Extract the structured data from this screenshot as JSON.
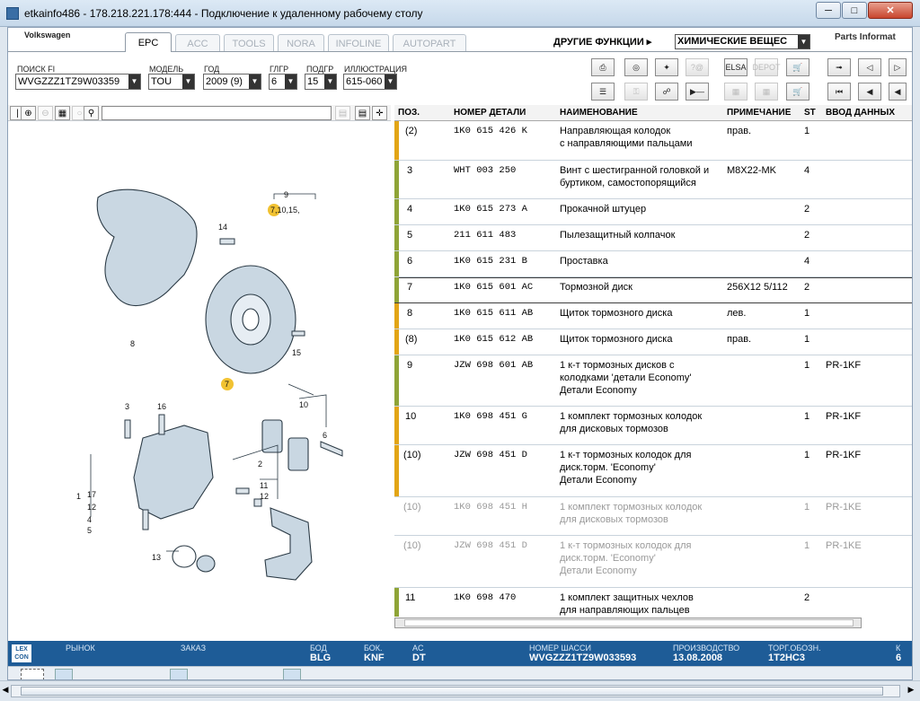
{
  "window": {
    "title": "etkainfo486 - 178.218.221.178:444 - Подключение к удаленному рабочему столу"
  },
  "header": {
    "brand": "Volkswagen",
    "parts_info": "Parts Informat",
    "other_functions": "ДРУГИЕ ФУНКЦИИ ▸",
    "chem_select": "ХИМИЧЕСКИЕ ВЕЩЕС"
  },
  "tabs": [
    {
      "label": "EPC"
    },
    {
      "label": "ACC"
    },
    {
      "label": "TOOLS"
    },
    {
      "label": "NORA"
    },
    {
      "label": "INFOLINE"
    },
    {
      "label": "AUTOPART"
    }
  ],
  "filters": {
    "search_label": "ПОИСК FI",
    "search_value": "WVGZZZ1TZ9W03359",
    "model_label": "МОДЕЛЬ",
    "model_value": "TOU",
    "year_label": "ГОД",
    "year_value": "2009 (9)",
    "mgroup_label": "ГЛГР",
    "mgroup_value": "6",
    "sgroup_label": "ПОДГР",
    "sgroup_value": "15",
    "illus_label": "ИЛЛЮСТРАЦИЯ",
    "illus_value": "615-060"
  },
  "toolbar": {
    "elsa": "ELSA",
    "depot": "DEPOT"
  },
  "table": {
    "headers": {
      "pos": "ПОЗ.",
      "part": "НОМЕР ДЕТАЛИ",
      "name": "НАИМЕНОВАНИЕ",
      "note": "ПРИМЕЧАНИЕ",
      "st": "ST",
      "input": "ВВОД ДАННЫХ"
    },
    "rows": [
      {
        "pos": "(2)",
        "part": "1K0 615 426 K",
        "name1": "Направляющая колодок",
        "name2": "с направляющими пальцами",
        "name3": "",
        "note": "прав.",
        "st": "1",
        "input": ""
      },
      {
        "pos": "3",
        "part": "WHT 003 250",
        "name1": "Винт с шестигранной головкой и",
        "name2": "буртиком, самостопорящийся",
        "name3": "",
        "note": "M8X22-MK",
        "st": "4",
        "input": ""
      },
      {
        "pos": "4",
        "part": "1K0 615 273 A",
        "name1": "Прокачной штуцер",
        "name2": "",
        "name3": "",
        "note": "",
        "st": "2",
        "input": ""
      },
      {
        "pos": "5",
        "part": "211 611 483",
        "name1": "Пылезащитный колпачок",
        "name2": "",
        "name3": "",
        "note": "",
        "st": "2",
        "input": ""
      },
      {
        "pos": "6",
        "part": "1K0 615 231 B",
        "name1": "Проставка",
        "name2": "",
        "name3": "",
        "note": "",
        "st": "4",
        "input": ""
      },
      {
        "pos": "7",
        "part": "1K0 615 601 AC",
        "name1": "Тормозной диск",
        "name2": "",
        "name3": "",
        "note": "256X12  5/112",
        "st": "2",
        "input": ""
      },
      {
        "pos": "8",
        "part": "1K0 615 611 AB",
        "name1": "Щиток тормозного диска",
        "name2": "",
        "name3": "",
        "note": "лев.",
        "st": "1",
        "input": ""
      },
      {
        "pos": "(8)",
        "part": "1K0 615 612 AB",
        "name1": "Щиток тормозного диска",
        "name2": "",
        "name3": "",
        "note": "прав.",
        "st": "1",
        "input": ""
      },
      {
        "pos": "9",
        "part": "JZW 698 601 AB",
        "name1": "1 к-т тормозных дисков с",
        "name2": "колодками   'детали Economy'",
        "name3": "Детали Economy",
        "note": "",
        "st": "1",
        "input": "PR-1KF"
      },
      {
        "pos": "10",
        "part": "1K0 698 451 G",
        "name1": "1 комплект тормозных колодок",
        "name2": "для дисковых тормозов",
        "name3": "",
        "note": "",
        "st": "1",
        "input": "PR-1KF"
      },
      {
        "pos": "(10)",
        "part": "JZW 698 451 D",
        "name1": "1 к-т тормозных колодок для",
        "name2": "диск.торм.          'Economy'",
        "name3": "Детали Economy",
        "note": "",
        "st": "1",
        "input": "PR-1KF"
      },
      {
        "pos": "(10)",
        "part": "1K0 698 451 H",
        "name1": "1 комплект тормозных колодок",
        "name2": "для дисковых тормозов",
        "name3": "",
        "note": "",
        "st": "1",
        "input": "PR-1KE"
      },
      {
        "pos": "(10)",
        "part": "JZW 698 451 D",
        "name1": "1 к-т тормозных колодок для",
        "name2": "диск.торм.          'Economy'",
        "name3": "Детали Economy",
        "note": "",
        "st": "1",
        "input": "PR-1KE"
      },
      {
        "pos": "11",
        "part": "1K0 698 470",
        "name1": "1 комплект защитных чехлов",
        "name2": "для направляющих пальцев",
        "name3": "",
        "note": "",
        "st": "2",
        "input": ""
      }
    ]
  },
  "illustration": {
    "labels": [
      "9",
      "7,10,15,",
      "14",
      "8",
      "7",
      "15",
      "3",
      "16",
      "10",
      "6",
      "1",
      "17",
      "12",
      "4",
      "5",
      "2",
      "11",
      "12",
      "13"
    ]
  },
  "status": {
    "lexcon": "LEX CON",
    "market_label": "РЫНОК",
    "order_label": "ЗАКАЗ",
    "bod_label": "БОД",
    "bod_value": "BLG",
    "bok_label": "БОК.",
    "bok_value": "KNF",
    "ac_label": "AC",
    "ac_value": "DT",
    "chassis_label": "НОМЕР ШАССИ",
    "chassis_value": "WVGZZZ1TZ9W033593",
    "production_label": "ПРОИЗВОДСТВО",
    "production_value": "13.08.2008",
    "gearbox_label": "ТОРГ.ОБОЗН.",
    "gearbox_value": "1T2HC3",
    "k_label": "К",
    "k_value": "6"
  },
  "colors": {
    "status_bar": "#1e5c97",
    "mark_yellow": "#e2a516",
    "mark_green": "#8fa437",
    "callout_yellow": "#f1c232"
  }
}
